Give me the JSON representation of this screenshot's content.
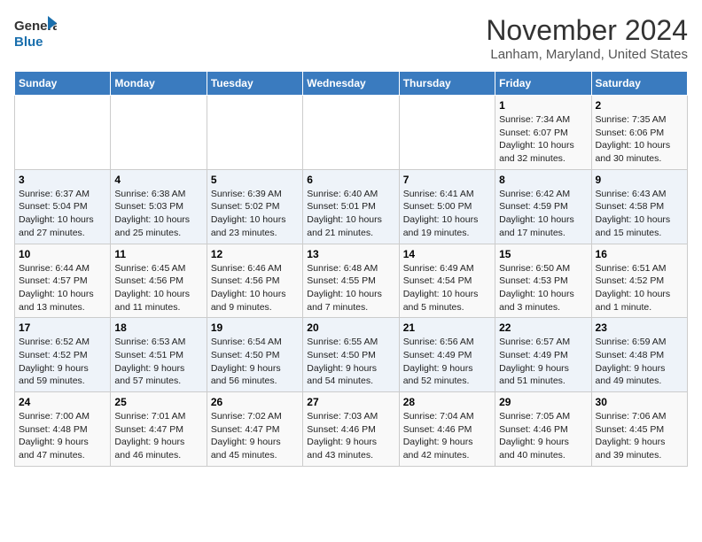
{
  "header": {
    "logo_line1": "General",
    "logo_line2": "Blue",
    "title": "November 2024",
    "subtitle": "Lanham, Maryland, United States"
  },
  "weekdays": [
    "Sunday",
    "Monday",
    "Tuesday",
    "Wednesday",
    "Thursday",
    "Friday",
    "Saturday"
  ],
  "weeks": [
    [
      {
        "day": "",
        "info": ""
      },
      {
        "day": "",
        "info": ""
      },
      {
        "day": "",
        "info": ""
      },
      {
        "day": "",
        "info": ""
      },
      {
        "day": "",
        "info": ""
      },
      {
        "day": "1",
        "info": "Sunrise: 7:34 AM\nSunset: 6:07 PM\nDaylight: 10 hours\nand 32 minutes."
      },
      {
        "day": "2",
        "info": "Sunrise: 7:35 AM\nSunset: 6:06 PM\nDaylight: 10 hours\nand 30 minutes."
      }
    ],
    [
      {
        "day": "3",
        "info": "Sunrise: 6:37 AM\nSunset: 5:04 PM\nDaylight: 10 hours\nand 27 minutes."
      },
      {
        "day": "4",
        "info": "Sunrise: 6:38 AM\nSunset: 5:03 PM\nDaylight: 10 hours\nand 25 minutes."
      },
      {
        "day": "5",
        "info": "Sunrise: 6:39 AM\nSunset: 5:02 PM\nDaylight: 10 hours\nand 23 minutes."
      },
      {
        "day": "6",
        "info": "Sunrise: 6:40 AM\nSunset: 5:01 PM\nDaylight: 10 hours\nand 21 minutes."
      },
      {
        "day": "7",
        "info": "Sunrise: 6:41 AM\nSunset: 5:00 PM\nDaylight: 10 hours\nand 19 minutes."
      },
      {
        "day": "8",
        "info": "Sunrise: 6:42 AM\nSunset: 4:59 PM\nDaylight: 10 hours\nand 17 minutes."
      },
      {
        "day": "9",
        "info": "Sunrise: 6:43 AM\nSunset: 4:58 PM\nDaylight: 10 hours\nand 15 minutes."
      }
    ],
    [
      {
        "day": "10",
        "info": "Sunrise: 6:44 AM\nSunset: 4:57 PM\nDaylight: 10 hours\nand 13 minutes."
      },
      {
        "day": "11",
        "info": "Sunrise: 6:45 AM\nSunset: 4:56 PM\nDaylight: 10 hours\nand 11 minutes."
      },
      {
        "day": "12",
        "info": "Sunrise: 6:46 AM\nSunset: 4:56 PM\nDaylight: 10 hours\nand 9 minutes."
      },
      {
        "day": "13",
        "info": "Sunrise: 6:48 AM\nSunset: 4:55 PM\nDaylight: 10 hours\nand 7 minutes."
      },
      {
        "day": "14",
        "info": "Sunrise: 6:49 AM\nSunset: 4:54 PM\nDaylight: 10 hours\nand 5 minutes."
      },
      {
        "day": "15",
        "info": "Sunrise: 6:50 AM\nSunset: 4:53 PM\nDaylight: 10 hours\nand 3 minutes."
      },
      {
        "day": "16",
        "info": "Sunrise: 6:51 AM\nSunset: 4:52 PM\nDaylight: 10 hours\nand 1 minute."
      }
    ],
    [
      {
        "day": "17",
        "info": "Sunrise: 6:52 AM\nSunset: 4:52 PM\nDaylight: 9 hours\nand 59 minutes."
      },
      {
        "day": "18",
        "info": "Sunrise: 6:53 AM\nSunset: 4:51 PM\nDaylight: 9 hours\nand 57 minutes."
      },
      {
        "day": "19",
        "info": "Sunrise: 6:54 AM\nSunset: 4:50 PM\nDaylight: 9 hours\nand 56 minutes."
      },
      {
        "day": "20",
        "info": "Sunrise: 6:55 AM\nSunset: 4:50 PM\nDaylight: 9 hours\nand 54 minutes."
      },
      {
        "day": "21",
        "info": "Sunrise: 6:56 AM\nSunset: 4:49 PM\nDaylight: 9 hours\nand 52 minutes."
      },
      {
        "day": "22",
        "info": "Sunrise: 6:57 AM\nSunset: 4:49 PM\nDaylight: 9 hours\nand 51 minutes."
      },
      {
        "day": "23",
        "info": "Sunrise: 6:59 AM\nSunset: 4:48 PM\nDaylight: 9 hours\nand 49 minutes."
      }
    ],
    [
      {
        "day": "24",
        "info": "Sunrise: 7:00 AM\nSunset: 4:48 PM\nDaylight: 9 hours\nand 47 minutes."
      },
      {
        "day": "25",
        "info": "Sunrise: 7:01 AM\nSunset: 4:47 PM\nDaylight: 9 hours\nand 46 minutes."
      },
      {
        "day": "26",
        "info": "Sunrise: 7:02 AM\nSunset: 4:47 PM\nDaylight: 9 hours\nand 45 minutes."
      },
      {
        "day": "27",
        "info": "Sunrise: 7:03 AM\nSunset: 4:46 PM\nDaylight: 9 hours\nand 43 minutes."
      },
      {
        "day": "28",
        "info": "Sunrise: 7:04 AM\nSunset: 4:46 PM\nDaylight: 9 hours\nand 42 minutes."
      },
      {
        "day": "29",
        "info": "Sunrise: 7:05 AM\nSunset: 4:46 PM\nDaylight: 9 hours\nand 40 minutes."
      },
      {
        "day": "30",
        "info": "Sunrise: 7:06 AM\nSunset: 4:45 PM\nDaylight: 9 hours\nand 39 minutes."
      }
    ]
  ]
}
